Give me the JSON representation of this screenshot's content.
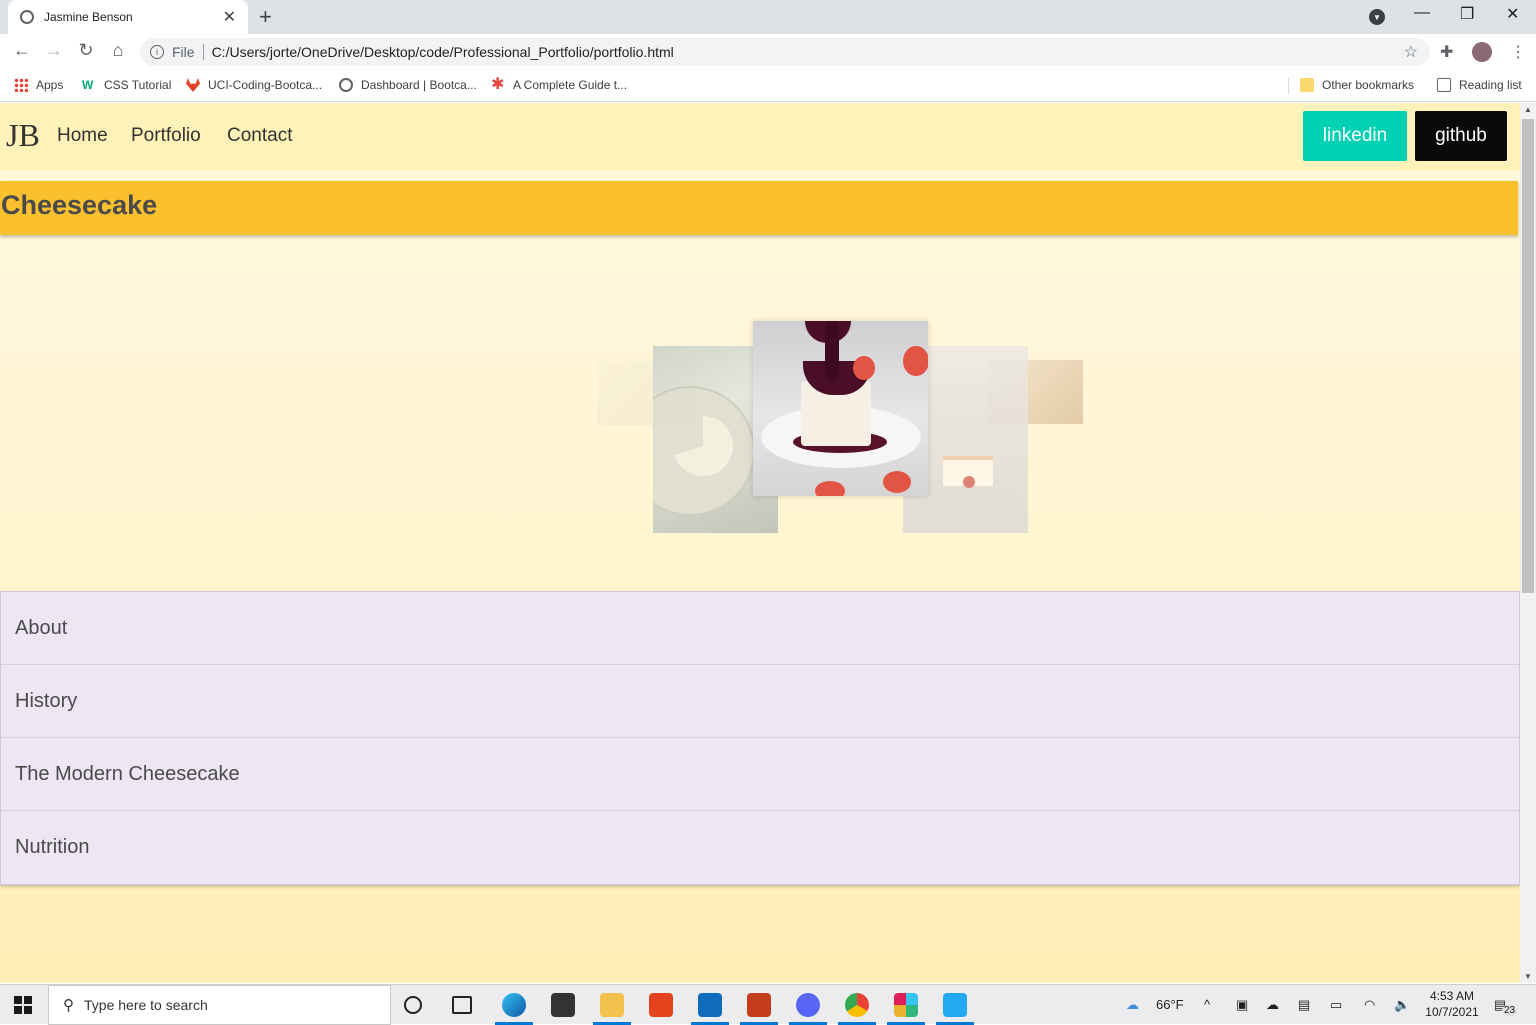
{
  "browser": {
    "tab_title": "Jasmine Benson",
    "address": "C:/Users/jorte/OneDrive/Desktop/code/Professional_Portfolio/portfolio.html",
    "scheme_label": "File",
    "bookmarks": [
      "Apps",
      "CSS Tutorial",
      "UCI-Coding-Bootca...",
      "Dashboard | Bootca...",
      "A Complete Guide t..."
    ],
    "other_bookmarks": "Other bookmarks",
    "reading_list": "Reading list"
  },
  "site": {
    "brand": "JB",
    "nav": [
      "Home",
      "Portfolio",
      "Contact"
    ],
    "buttons": {
      "linkedin": "linkedin",
      "github": "github"
    },
    "banner_title": "Cheesecake",
    "accordion": [
      "About",
      "History",
      "The Modern Cheesecake",
      "Nutrition"
    ],
    "colors": {
      "nav_bg": "#fff2b8",
      "banner": "#fbc02d",
      "linkedin": "#00d1b2",
      "github": "#0a0a0a",
      "accordion_bg": "#ede6f4"
    }
  },
  "taskbar": {
    "search_placeholder": "Type here to search",
    "weather": "66°F",
    "time": "4:53 AM",
    "date": "10/7/2021",
    "notifications": "23"
  }
}
